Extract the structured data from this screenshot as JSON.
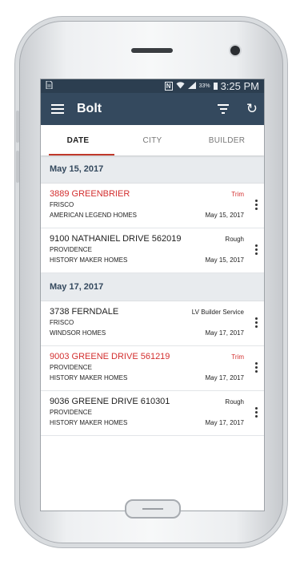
{
  "status_bar": {
    "left_icon": "sd-card-icon",
    "nfc_label": "N",
    "battery_pct": "33%",
    "time": "3:25 PM"
  },
  "app_bar": {
    "title": "Bolt",
    "icons": [
      "menu-icon",
      "filter-icon",
      "refresh-icon"
    ],
    "color": "#34495e",
    "status_color": "#2c3e50",
    "accent": "#c0392b"
  },
  "tabs": {
    "date": "DATE",
    "city": "CITY",
    "builder": "BUILDER",
    "active": "DATE"
  },
  "groups": [
    {
      "date": "May 15, 2017",
      "jobs": [
        {
          "address": "3889 GREENBRIER",
          "city": "FRISCO",
          "builder": "AMERICAN LEGEND HOMES",
          "type": "Trim",
          "date": "May 15, 2017",
          "highlight": true
        },
        {
          "address": "9100 NATHANIEL DRIVE 562019",
          "city": "PROVIDENCE",
          "builder": "HISTORY MAKER HOMES",
          "type": "Rough",
          "date": "May 15, 2017",
          "highlight": false
        }
      ]
    },
    {
      "date": "May 17, 2017",
      "jobs": [
        {
          "address": "3738 FERNDALE",
          "city": "FRISCO",
          "builder": "WINDSOR HOMES",
          "type": "LV Builder Service",
          "date": "May 17, 2017",
          "highlight": false
        },
        {
          "address": "9003 GREENE DRIVE 561219",
          "city": "PROVIDENCE",
          "builder": "HISTORY MAKER HOMES",
          "type": "Trim",
          "date": "May 17, 2017",
          "highlight": true
        },
        {
          "address": "9036 GREENE DRIVE 610301",
          "city": "PROVIDENCE",
          "builder": "HISTORY MAKER HOMES",
          "type": "Rough",
          "date": "May 17, 2017",
          "highlight": false
        }
      ]
    }
  ]
}
